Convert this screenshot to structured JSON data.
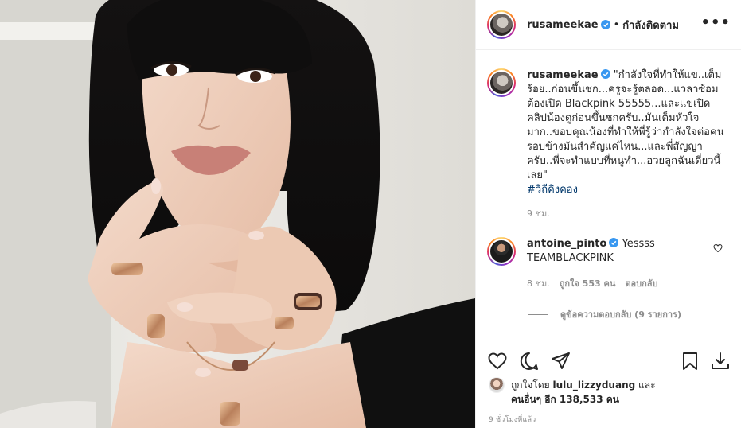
{
  "photo": {
    "alt_subject": "portrait-with-rings"
  },
  "header": {
    "username": "rusameekae",
    "separator": "•",
    "follow_label": "กำลังติดตาม",
    "more_label": "•••"
  },
  "caption": {
    "username": "rusameekae",
    "text": "\"กำลังใจที่ทำให้แข..เต็มร้อย..ก่อนขึ้นชก...ครูจะรู้ตลอด...แวลาซ้อมต้องเปิด Blackpink 55555...และแขเปิดคลิปน้องดูก่อนขึ้นชกครับ..มันเต็มหัวใจมาก..ขอบคุณน้องที่ทำให้พี่รู้ว่ากำลังใจต่อคนรอบข้างมันสำคัญแค่ไหน...และพี่สัญญาครับ..พี่จะทำแบบที่หนูทำ...อวยลูกฉันเดี๋ยวนี้เลย\"",
    "hashtag": "#วิถีคิงคอง",
    "time": "9 ชม."
  },
  "comment": {
    "username": "antoine_pinto",
    "text": "Yessss",
    "text2": "TEAMBLACKPINK",
    "time": "8 ชม.",
    "likes": "ถูกใจ 553 คน",
    "reply_label": "ตอบกลับ",
    "view_replies": "ดูข้อความตอบกลับ (9 รายการ)"
  },
  "likes": {
    "prefix": "ถูกใจโดย ",
    "user": "lulu_lizzyduang",
    "and": " และ",
    "others": "คนอื่นๆ อีก 138,533 คน"
  },
  "timestamp": "9 ชั่วโมงที่แล้ว",
  "colors": {
    "verified": "#3897f0",
    "hashtag": "#00376b",
    "muted": "#8e8e8e",
    "text": "#262626"
  }
}
